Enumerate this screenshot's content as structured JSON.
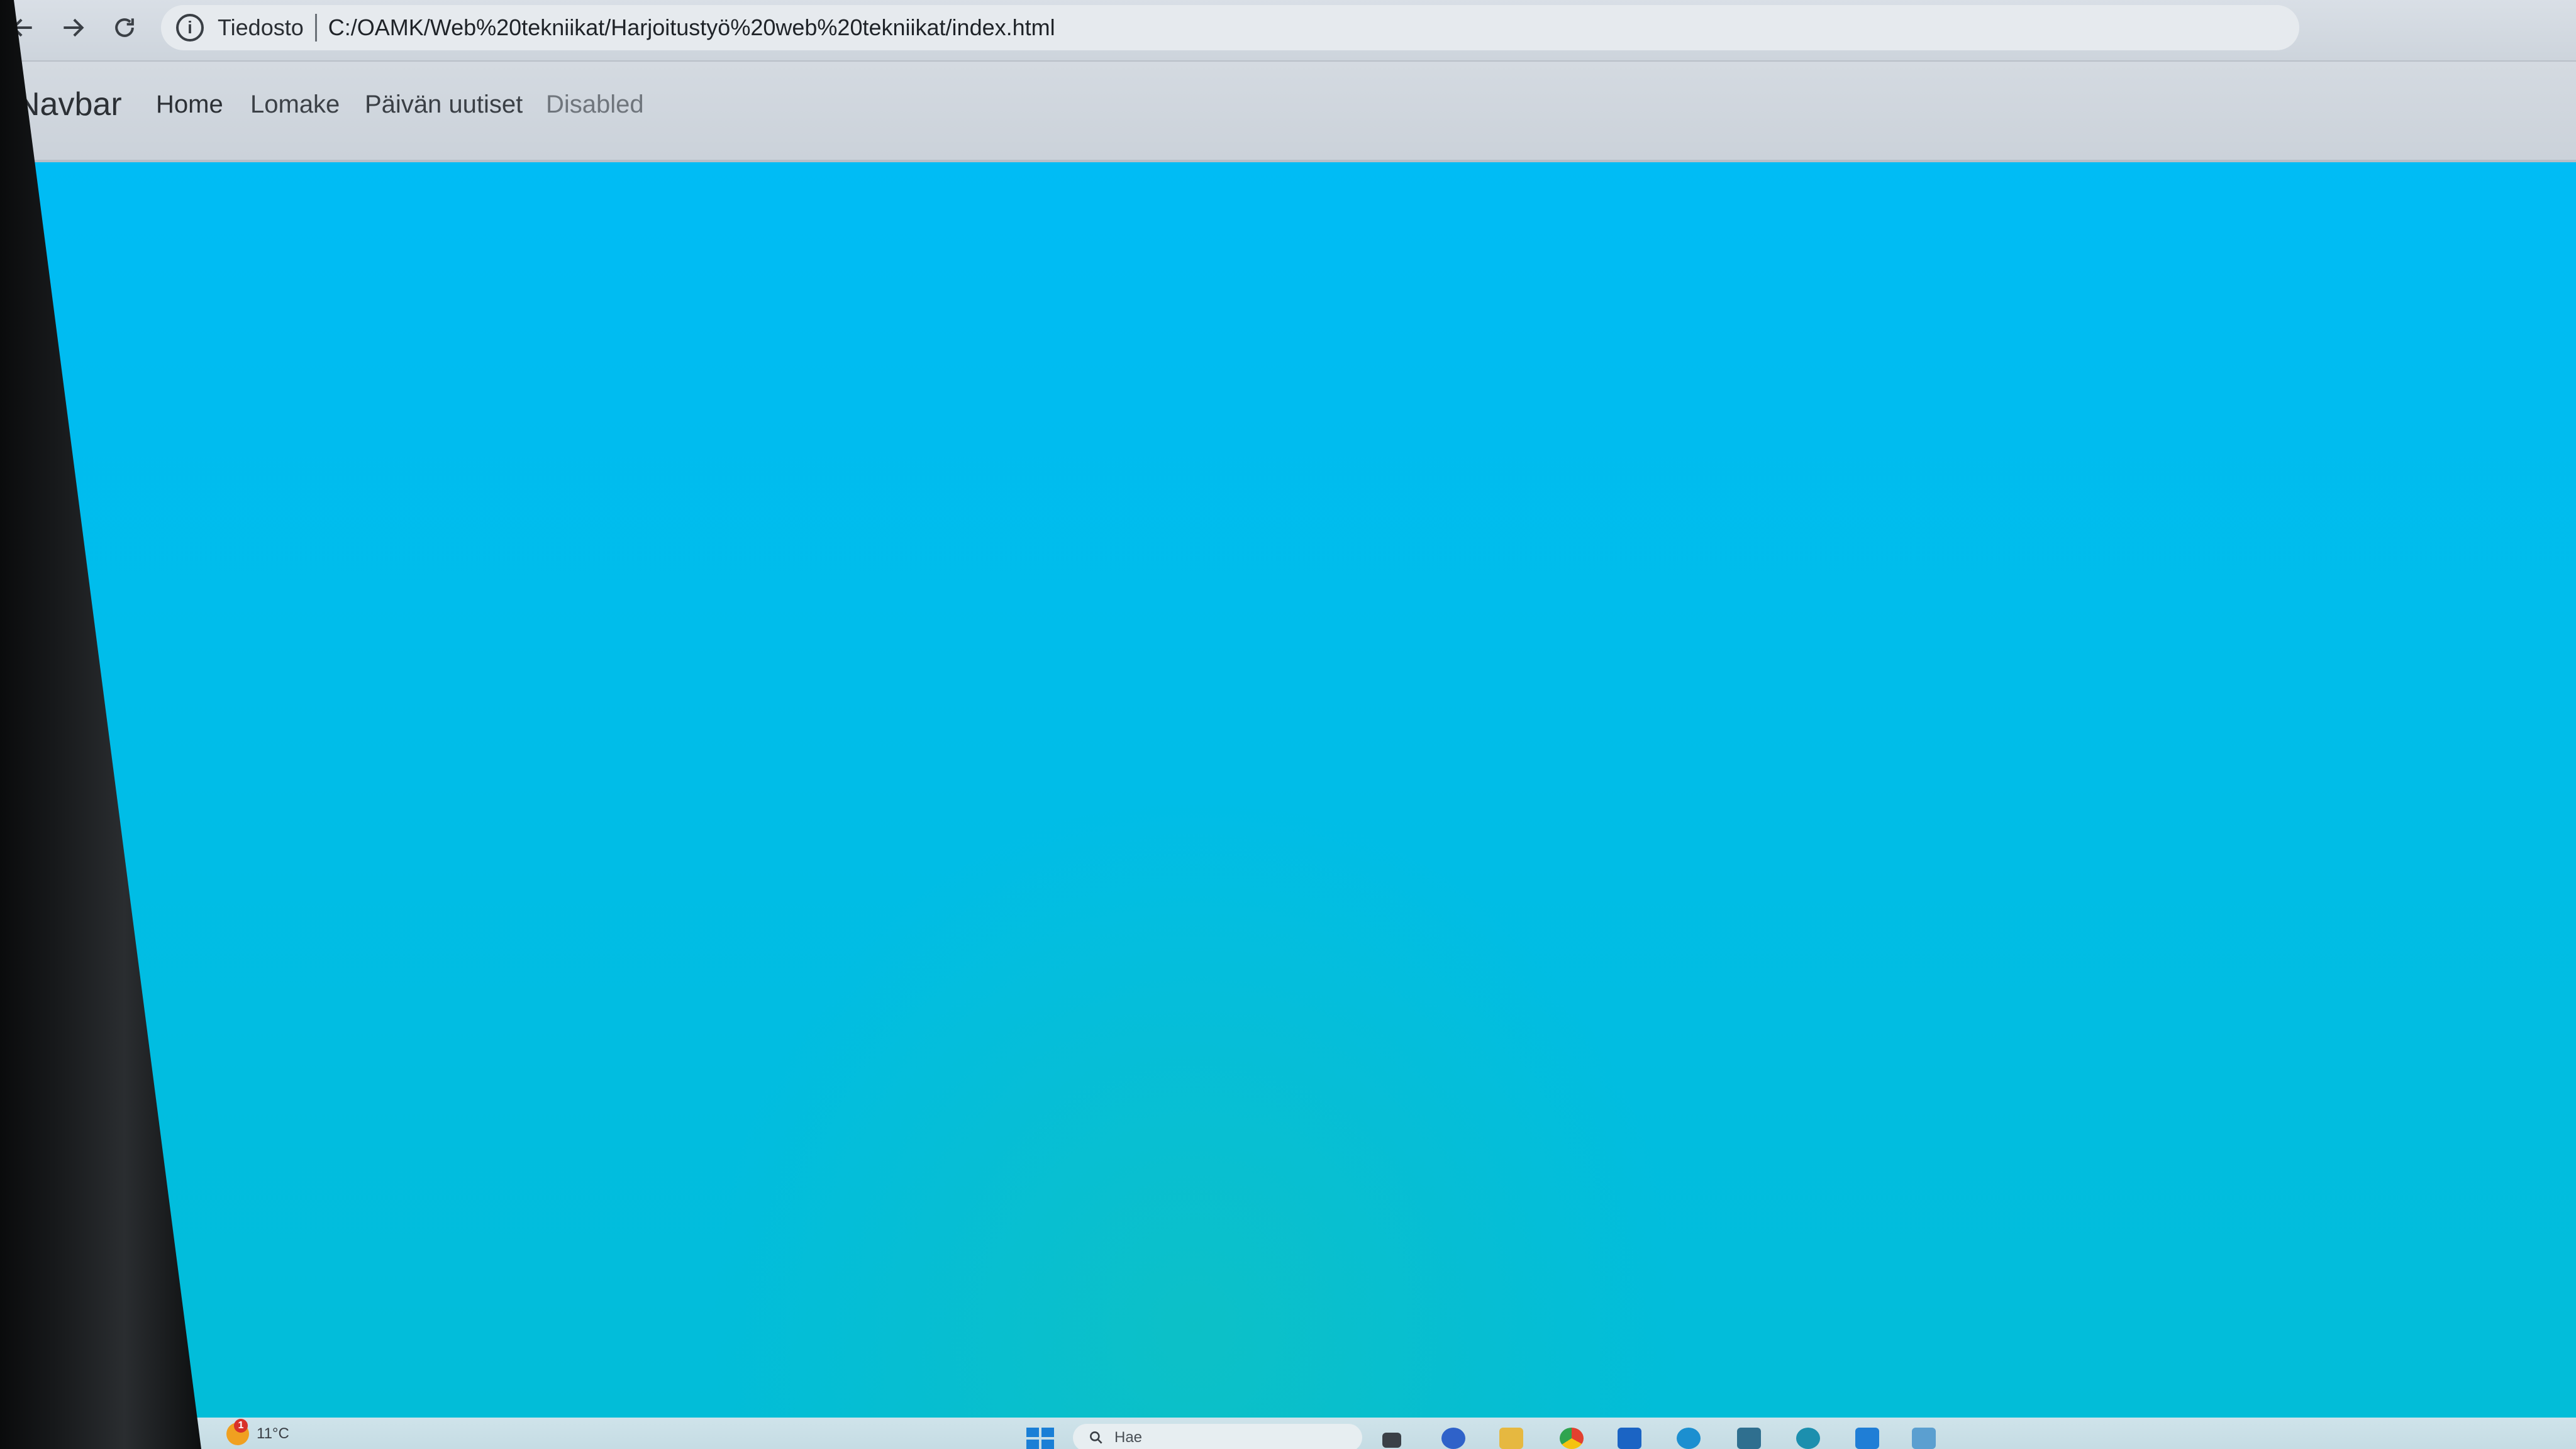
{
  "browser": {
    "scheme_label": "Tiedosto",
    "url": "C:/OAMK/Web%20tekniikat/Harjoitustyö%20web%20tekniikat/index.html",
    "back_icon": "back-arrow-icon",
    "forward_icon": "forward-arrow-icon",
    "reload_icon": "reload-icon",
    "info_icon": "info-icon",
    "info_glyph": "i"
  },
  "navbar": {
    "brand": "Navbar",
    "links": [
      {
        "label": "Home",
        "disabled": false
      },
      {
        "label": "Lomake",
        "disabled": false
      },
      {
        "label": "Päivän uutiset",
        "disabled": false
      },
      {
        "label": "Disabled",
        "disabled": true
      }
    ]
  },
  "page": {
    "background_color": "#00bcf5"
  },
  "taskbar": {
    "weather_badge": "1",
    "weather_temp": "11°C",
    "search_placeholder": "Hae",
    "icons": [
      "windows-start-icon",
      "search-icon",
      "task-view-icon",
      "app-icon",
      "folder-icon",
      "chrome-icon",
      "mail-icon",
      "edge-icon",
      "calculator-icon",
      "network-icon",
      "vscode-icon",
      "notepad-icon"
    ]
  },
  "colors": {
    "accent": "#00bcf5",
    "chrome": "#d4dae1",
    "text": "#2c3035"
  }
}
